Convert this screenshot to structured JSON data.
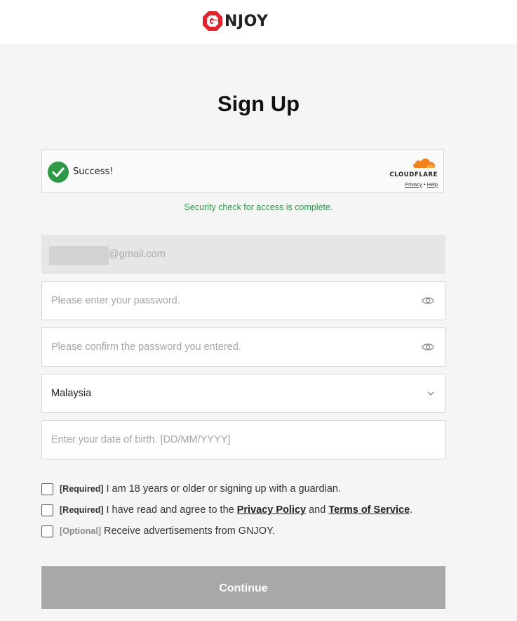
{
  "header": {
    "logo_text": "NJOY"
  },
  "page": {
    "title": "Sign Up"
  },
  "captcha": {
    "status": "Success!",
    "brand": "CLOUDFLARE",
    "privacy_link": "Privacy",
    "separator": "•",
    "help_link": "Help",
    "message": "Security check for access is complete."
  },
  "form": {
    "email_domain": "@gmail.com",
    "password_placeholder": "Please enter your password.",
    "confirm_placeholder": "Please confirm the password you entered.",
    "country_value": "Malaysia",
    "dob_placeholder": "Enter your date of birth. [DD/MM/YYYY]"
  },
  "consents": [
    {
      "tag": "[Required]",
      "text": "I am 18 years or older or signing up with a guardian."
    },
    {
      "tag": "[Required]",
      "text_before": "I have read and agree to the",
      "link1": "Privacy Policy",
      "text_mid": "and",
      "link2": "Terms of Service",
      "text_after": "."
    },
    {
      "tag": "[Optional]",
      "text": "Receive advertisements from GNJOY."
    }
  ],
  "actions": {
    "continue_label": "Continue"
  },
  "colors": {
    "brand_red": "#e0242b",
    "success_green": "#2e9a48",
    "cloudflare_orange": "#f48120",
    "button_disabled": "#a8a8a8"
  }
}
